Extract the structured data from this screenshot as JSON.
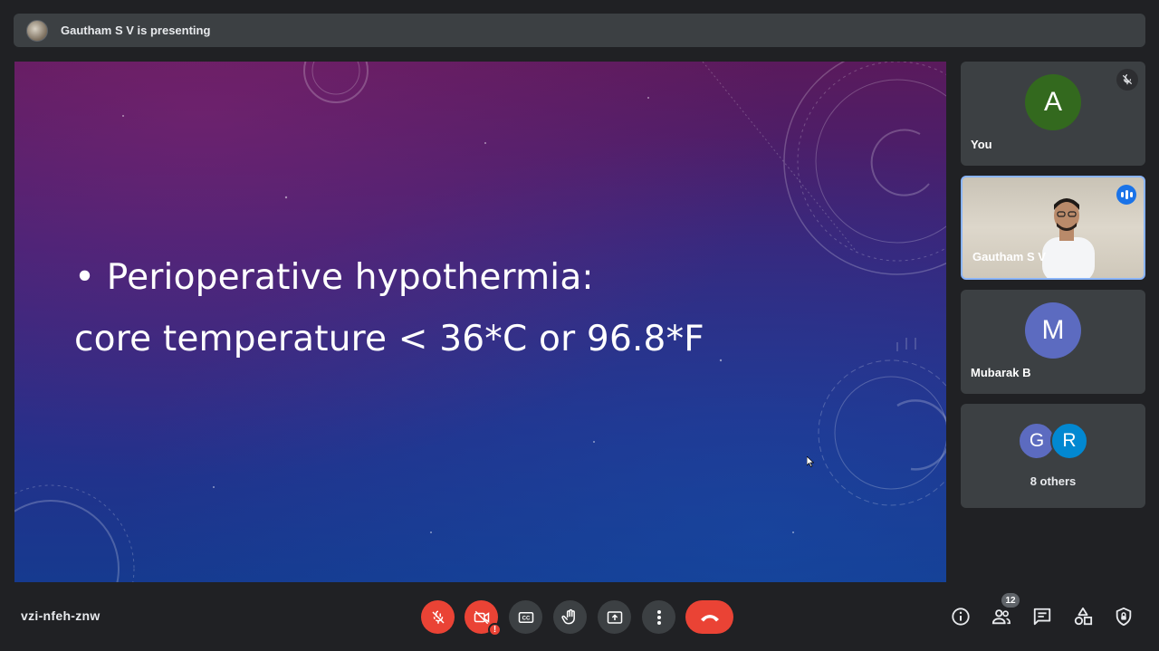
{
  "presenting_bar": {
    "text": "Gautham S V is presenting"
  },
  "slide": {
    "line1": "• Perioperative hypothermia:",
    "line2": "core temperature < 36*C or 96.8*F"
  },
  "participants": [
    {
      "name": "You",
      "initial": "A",
      "avatar_color": "#33691e",
      "muted": true
    },
    {
      "name": "Gautham S V",
      "video": true,
      "speaking": true
    },
    {
      "name": "Mubarak B",
      "initial": "M",
      "avatar_color": "#5c6bc0"
    }
  ],
  "others": {
    "initials": [
      "G",
      "R"
    ],
    "colors": [
      "#5c6bc0",
      "#0288d1"
    ],
    "label": "8 others"
  },
  "meeting_code": "vzi-nfeh-znw",
  "controls": [
    "mic-off-icon",
    "camera-off-icon",
    "captions-icon",
    "raise-hand-icon",
    "present-icon",
    "more-icon",
    "end-call-icon"
  ],
  "camera_alert": "!",
  "people_count": "12",
  "colors": {
    "bg": "#202124",
    "surface": "#3c4043",
    "danger": "#ea4335",
    "accent": "#8ab4f8"
  }
}
